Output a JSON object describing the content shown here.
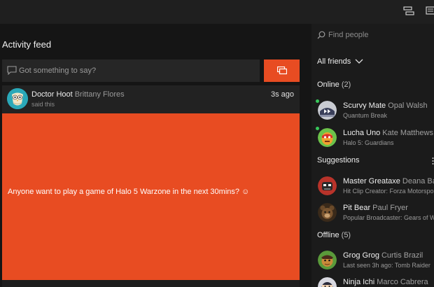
{
  "topbar": {
    "icons": [
      "party-icon",
      "messages-icon"
    ]
  },
  "feed": {
    "title": "Activity feed",
    "composer_placeholder": "Got something to say?",
    "post": {
      "gamertag": "Doctor Hoot",
      "realname": "Brittany Flores",
      "subtitle": "said this",
      "time": "3s ago",
      "text": "Anyone want to play a game of Halo 5 Warzone in the next 30mins? ☺",
      "color": "#e84c22"
    }
  },
  "sidebar": {
    "search_placeholder": "Find people",
    "filter_label": "All friends",
    "online": {
      "label": "Online",
      "count": "(2)",
      "friends": [
        {
          "gamertag": "Scurvy Mate",
          "realname": "Opal Walsh",
          "status": "Quantum Break"
        },
        {
          "gamertag": "Lucha Uno",
          "realname": "Kate Matthews",
          "status": "Halo 5: Guardians"
        }
      ]
    },
    "suggestions": {
      "label": "Suggestions",
      "friends": [
        {
          "gamertag": "Master Greataxe",
          "realname": "Deana Barr",
          "status": "Hit Clip Creator: Forza Motorsport"
        },
        {
          "gamertag": "Pit Bear",
          "realname": "Paul Fryer",
          "status": "Popular Broadcaster: Gears of War"
        }
      ]
    },
    "offline": {
      "label": "Offline",
      "count": "(5)",
      "friends": [
        {
          "gamertag": "Grog Grog",
          "realname": "Curtis Brazil",
          "status": "Last seen 3h ago: Tomb Raider"
        },
        {
          "gamertag": "Ninja Ichi",
          "realname": "Marco Cabrera",
          "status": ""
        }
      ]
    }
  },
  "colors": {
    "accent": "#e84c22",
    "online": "#37c65a"
  }
}
